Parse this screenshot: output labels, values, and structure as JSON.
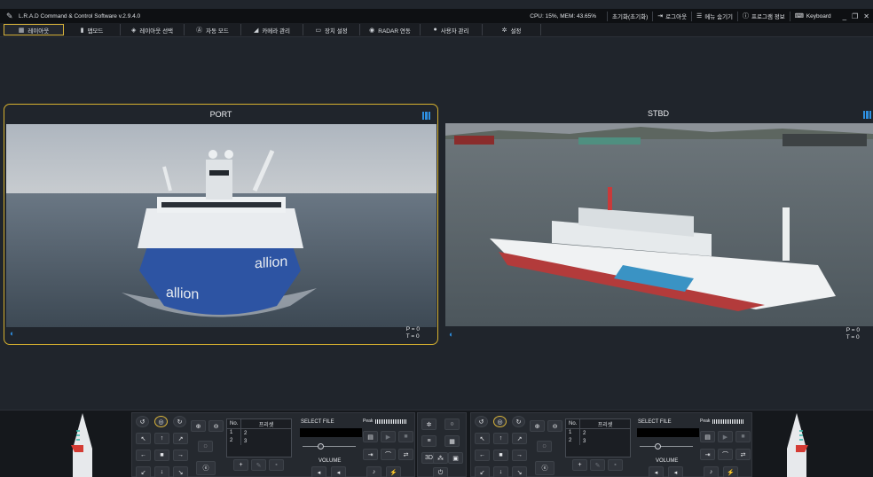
{
  "titlebar": {
    "app_title": "L.R.A.D Command & Control Software v.2.9.4.0",
    "cpu_mem": "CPU: 15%, MEM: 43.65%",
    "reset_label": "초기화(초기화)",
    "logout_label": "로그아웃",
    "hide_menu_label": "메뉴 숨기기",
    "program_info_label": "프로그램 정보",
    "keyboard_label": "Keyboard"
  },
  "menu": {
    "items": [
      {
        "label": "레이아웃",
        "icon": "grid-icon"
      },
      {
        "label": "맵모드",
        "icon": "map-icon"
      },
      {
        "label": "레이아웃 선택",
        "icon": "layers-icon"
      },
      {
        "label": "자동 모드",
        "icon": "auto-icon"
      },
      {
        "label": "카메라 관리",
        "icon": "camera-icon"
      },
      {
        "label": "장치 설정",
        "icon": "device-icon"
      },
      {
        "label": "RADAR 연동",
        "icon": "radar-icon"
      },
      {
        "label": "사용자 관리",
        "icon": "user-icon"
      },
      {
        "label": "설정",
        "icon": "gear-icon"
      }
    ],
    "active_index": 0
  },
  "cameras": {
    "port": {
      "title": "PORT",
      "p": "P = 0",
      "t": "T = 0"
    },
    "stbd": {
      "title": "STBD",
      "p": "P = 0",
      "t": "T = 0"
    }
  },
  "control_left": {
    "preset_header_no": "No.",
    "preset_header_name": "프리셋",
    "presets": [
      {
        "no": "1",
        "name": "2"
      },
      {
        "no": "2",
        "name": "3"
      }
    ],
    "select_file_label": "SELECT FILE",
    "peak_label": "Peak",
    "volume_label": "VOLUME"
  },
  "control_right": {
    "preset_header_no": "No.",
    "preset_header_name": "프리셋",
    "presets": [
      {
        "no": "1",
        "name": "2"
      },
      {
        "no": "2",
        "name": "3"
      }
    ],
    "select_file_label": "SELECT FILE",
    "peak_label": "Peak",
    "volume_label": "VOLUME"
  },
  "colors": {
    "accent": "#d6b12f",
    "blue": "#2e8fe0",
    "background": "#20252c"
  }
}
